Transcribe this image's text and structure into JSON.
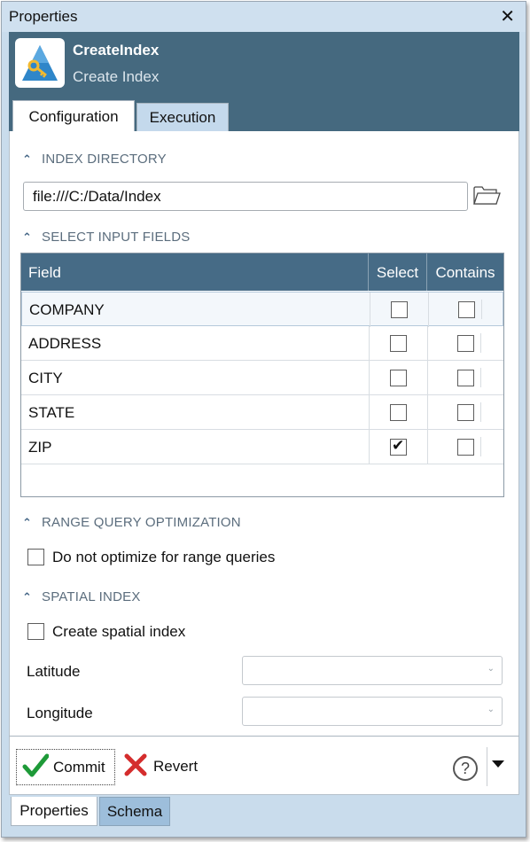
{
  "window": {
    "title": "Properties",
    "close_glyph": "✕"
  },
  "header": {
    "icon": "create-index-app-icon",
    "name": "CreateIndex",
    "subname": "Create Index",
    "tabs": [
      {
        "label": "Configuration"
      },
      {
        "label": "Execution"
      }
    ],
    "active_tab": "Configuration"
  },
  "index_directory": {
    "heading": "INDEX DIRECTORY",
    "value": "file:///C:/Data/Index"
  },
  "input_fields": {
    "heading": "SELECT INPUT FIELDS",
    "columns": {
      "field": "Field",
      "select": "Select",
      "contains": "Contains"
    },
    "rows": [
      {
        "field": "COMPANY",
        "select": false,
        "contains": false
      },
      {
        "field": "ADDRESS",
        "select": false,
        "contains": false
      },
      {
        "field": "CITY",
        "select": false,
        "contains": false
      },
      {
        "field": "STATE",
        "select": false,
        "contains": false
      },
      {
        "field": "ZIP",
        "select": true,
        "contains": false
      }
    ],
    "check_glyph": "✔"
  },
  "range_query": {
    "heading": "RANGE QUERY OPTIMIZATION",
    "option_label": "Do not optimize for range queries",
    "checked": false
  },
  "spatial_index": {
    "heading": "SPATIAL INDEX",
    "option_label": "Create spatial index",
    "checked": false,
    "latitude_label": "Latitude",
    "latitude_value": "",
    "longitude_label": "Longitude",
    "longitude_value": ""
  },
  "toolbar": {
    "commit_label": "Commit",
    "revert_label": "Revert",
    "help_glyph": "?"
  },
  "bottom_tabs": [
    {
      "label": "Properties"
    },
    {
      "label": "Schema"
    }
  ],
  "colors": {
    "header_bg": "#45697f",
    "grid_header_bg": "#466b86",
    "commit_green": "#1e9a38",
    "revert_red": "#d42d2d",
    "section_text": "#5b6d7d"
  }
}
